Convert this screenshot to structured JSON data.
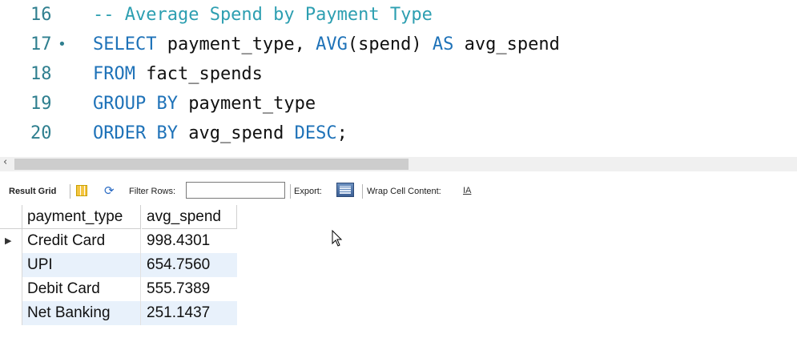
{
  "editor": {
    "lines": [
      {
        "num": "16",
        "marker": "",
        "parts": [
          {
            "t": "-- Average Spend by Payment Type",
            "c": "cm"
          }
        ]
      },
      {
        "num": "17",
        "marker": "•",
        "parts": [
          {
            "t": "SELECT",
            "c": "kw"
          },
          {
            "t": " payment_type, ",
            "c": ""
          },
          {
            "t": "AVG",
            "c": "kw"
          },
          {
            "t": "(spend) ",
            "c": ""
          },
          {
            "t": "AS",
            "c": "kw"
          },
          {
            "t": " avg_spend",
            "c": ""
          }
        ]
      },
      {
        "num": "18",
        "marker": "",
        "parts": [
          {
            "t": "FROM",
            "c": "kw"
          },
          {
            "t": " fact_spends",
            "c": ""
          }
        ]
      },
      {
        "num": "19",
        "marker": "",
        "parts": [
          {
            "t": "GROUP BY",
            "c": "kw"
          },
          {
            "t": " payment_type",
            "c": ""
          }
        ]
      },
      {
        "num": "20",
        "marker": "",
        "parts": [
          {
            "t": "ORDER BY",
            "c": "kw"
          },
          {
            "t": " avg_spend ",
            "c": ""
          },
          {
            "t": "DESC",
            "c": "kw"
          },
          {
            "t": ";",
            "c": ""
          }
        ]
      }
    ]
  },
  "scrollbar": {
    "left_arrow": "‹"
  },
  "toolbar": {
    "result_grid_label": "Result Grid",
    "filter_label": "Filter Rows:",
    "filter_value": "",
    "export_label": "Export:",
    "wrap_label": "Wrap Cell Content:",
    "wrap_icon_text": "IA"
  },
  "result": {
    "columns": [
      "payment_type",
      "avg_spend"
    ],
    "rows": [
      [
        "Credit Card",
        "998.4301"
      ],
      [
        "UPI",
        "654.7560"
      ],
      [
        "Debit Card",
        "555.7389"
      ],
      [
        "Net Banking",
        "251.1437"
      ]
    ],
    "current_row_marker": "▶"
  }
}
